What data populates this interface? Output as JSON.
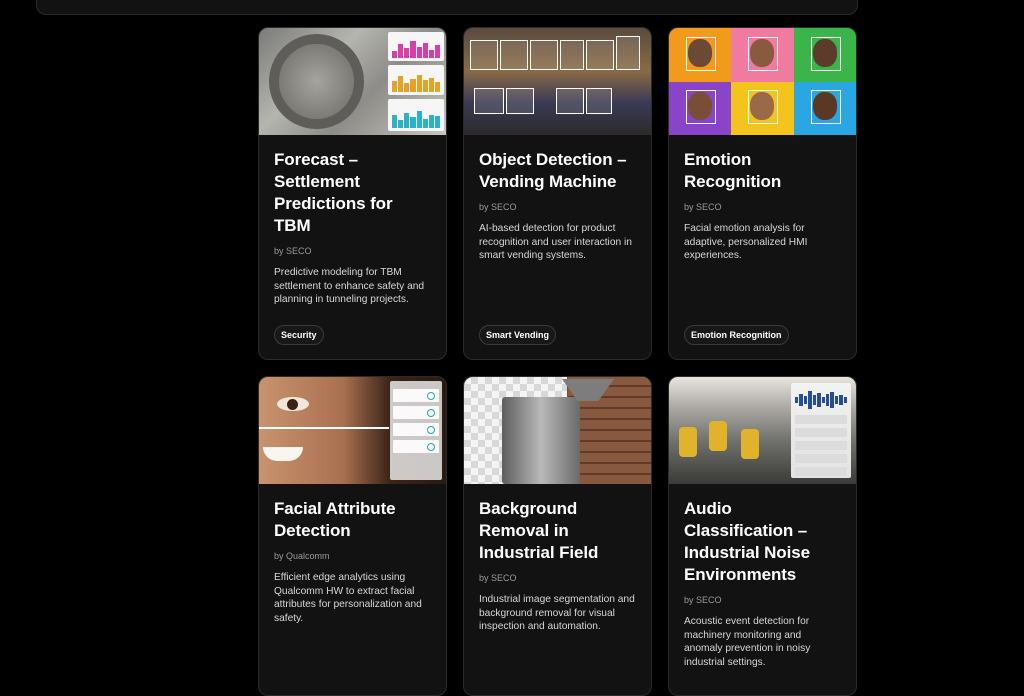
{
  "cards": [
    {
      "title": "Forecast – Settlement Predictions for TBM",
      "by": "by SECO",
      "description": "Predictive modeling for TBM settlement to enhance safety and planning in tunneling projects.",
      "tag": "Security",
      "thumb_icon": "tbm-settlement-chart-icon"
    },
    {
      "title": "Object Detection – Vending Machine",
      "by": "by SECO",
      "description": "AI-based detection for product recognition and user interaction in smart vending systems.",
      "tag": "Smart Vending",
      "thumb_icon": "vending-detection-icon"
    },
    {
      "title": "Emotion Recognition",
      "by": "by SECO",
      "description": "Facial emotion analysis for adaptive, personalized HMI experiences.",
      "tag": "Emotion Recognition",
      "thumb_icon": "emotion-faces-icon"
    },
    {
      "title": "Facial Attribute Detection",
      "by": "by Qualcomm",
      "description": "Efficient edge analytics using Qualcomm HW to extract facial attributes for personalization and safety.",
      "thumb_icon": "face-analysis-icon"
    },
    {
      "title": "Background Removal in Industrial Field",
      "by": "by SECO",
      "description": "Industrial image segmentation and background removal for visual inspection and automation.",
      "thumb_icon": "background-removal-icon"
    },
    {
      "title": "Audio Classification – Industrial Noise Environments",
      "by": "by SECO",
      "description": "Acoustic event detection for machinery monitoring and anomaly prevention in noisy industrial settings.",
      "thumb_icon": "audio-waveform-icon"
    }
  ],
  "colors": {
    "background": "#000000",
    "card": "#121212",
    "card_border": "#2b2b2b",
    "title": "#ffffff",
    "muted": "#9a9a9a"
  }
}
